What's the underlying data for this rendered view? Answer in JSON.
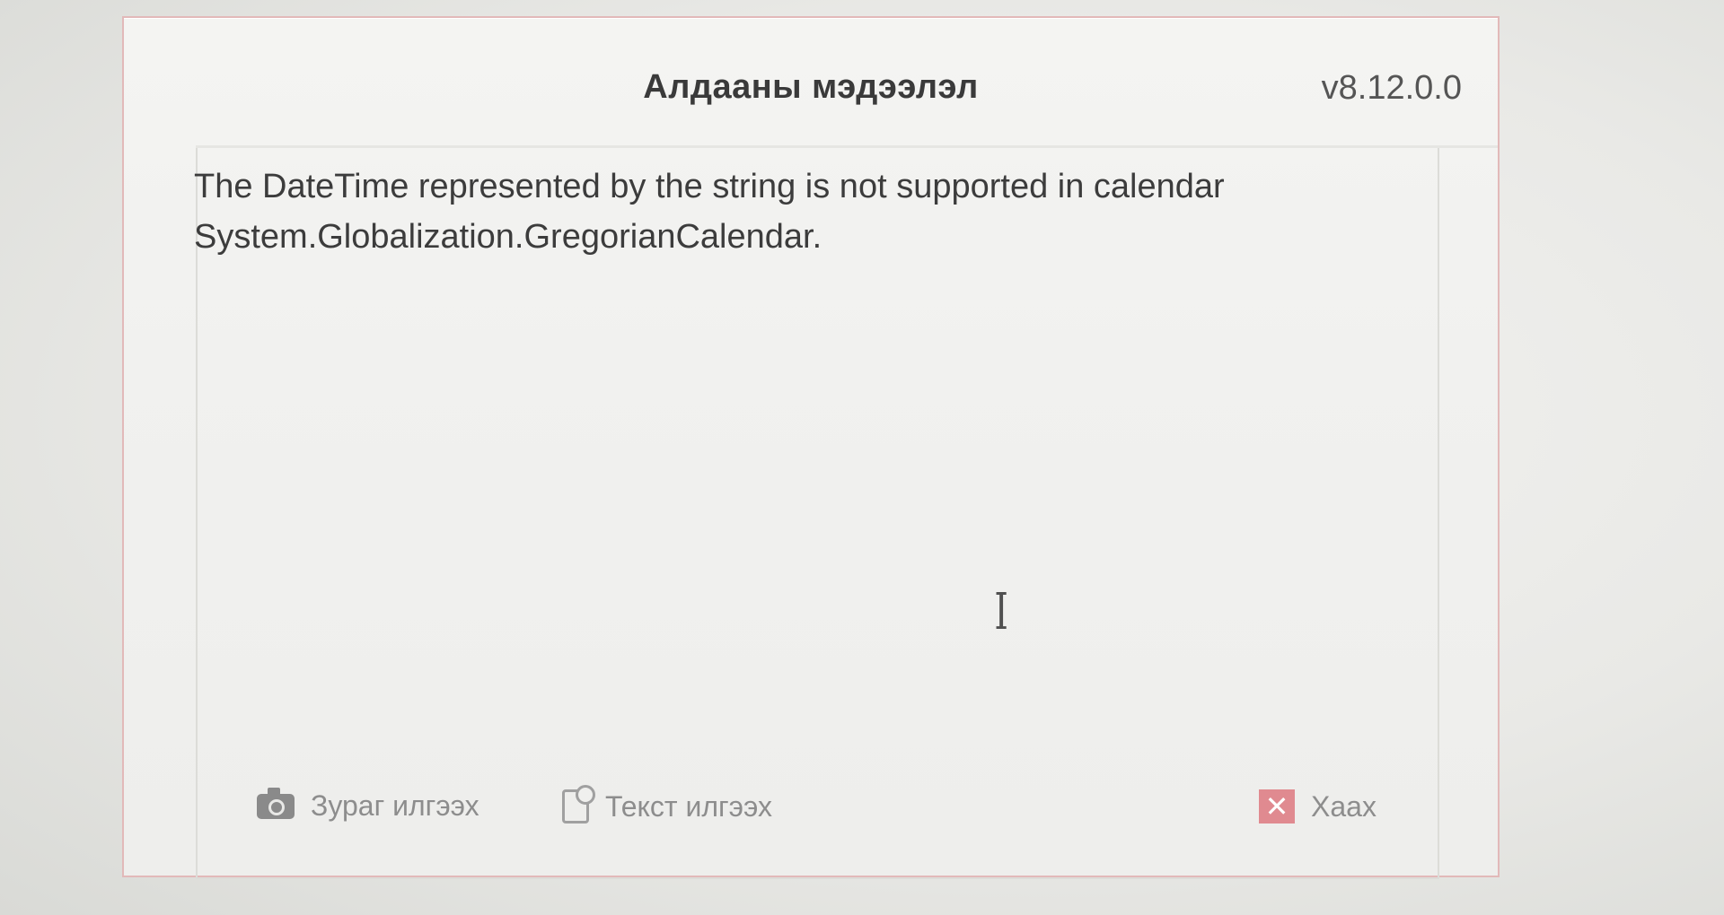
{
  "dialog": {
    "title": "Алдааны мэдээлэл",
    "version": "v8.12.0.0",
    "message": "The DateTime represented by the string is not supported in calendar\nSystem.Globalization.GregorianCalendar.",
    "cursor_glyph": "I"
  },
  "footer": {
    "capture_image_label": "Зураг илгээх",
    "capture_text_label": "Текст илгээх",
    "close_label": "Хаах",
    "close_glyph": "✕"
  },
  "colors": {
    "dialog_border": "#e2b9b9",
    "close_icon_bg": "#e08a90",
    "button_text": "#8d8d8d"
  },
  "icons": {
    "photo_button": "camera-icon",
    "text_button": "document-icon",
    "close_button": "close-icon"
  }
}
